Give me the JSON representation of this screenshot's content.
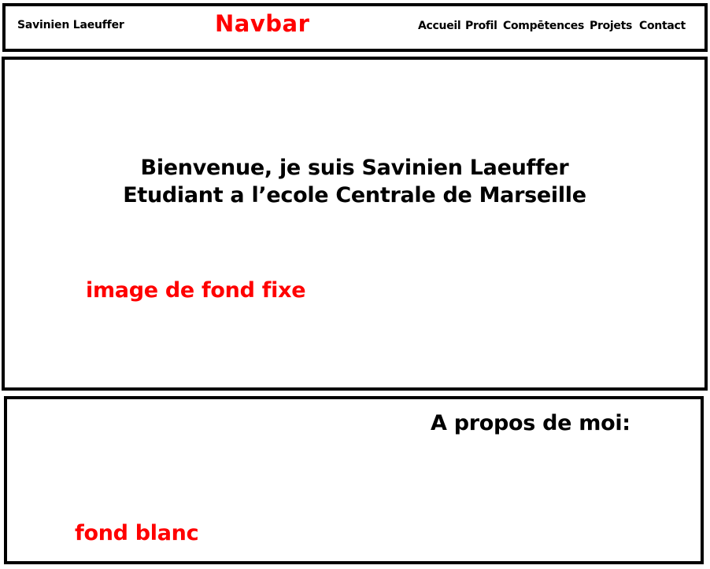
{
  "navbar": {
    "brand": "Savinien Laeuffer",
    "title": "Navbar",
    "links": [
      "Accueil",
      "Profil",
      "Compētences",
      "Projets",
      "Contact"
    ]
  },
  "hero": {
    "line1": "Bienvenue, je suis Savinien Laeuffer",
    "line2": "Etudiant a l’ecole Centrale de Marseille",
    "note": "image de fond fixe"
  },
  "about": {
    "title": "A propos de moi:",
    "note": "fond blanc"
  },
  "colors": {
    "accent": "#ff0000",
    "text": "#000000",
    "border": "#000000",
    "background": "#ffffff"
  }
}
